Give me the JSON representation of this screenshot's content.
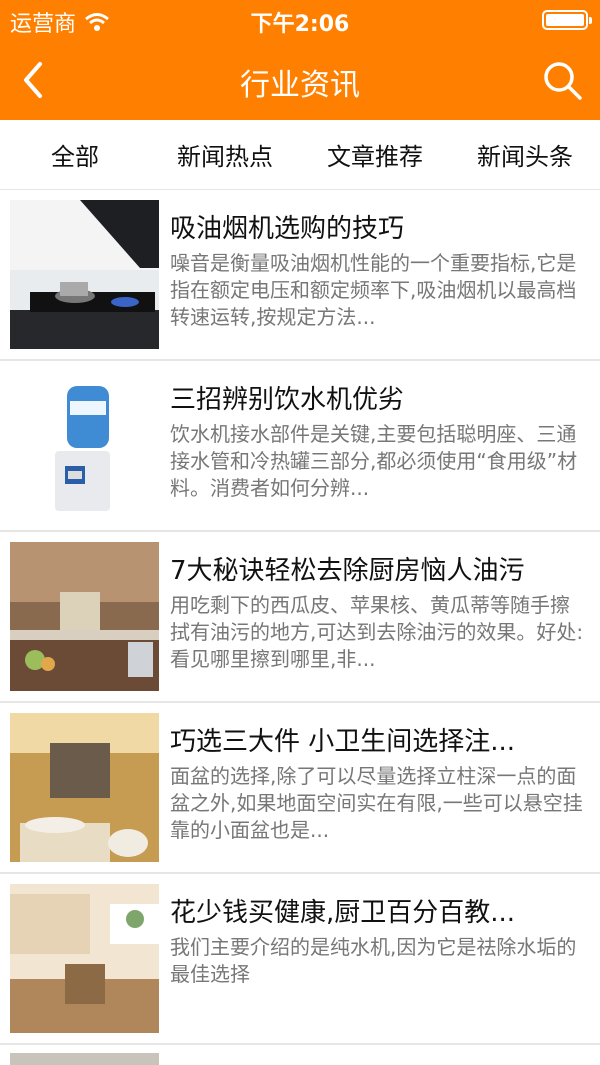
{
  "status": {
    "carrier": "运营商",
    "time": "下午2:06"
  },
  "header": {
    "title": "行业资讯",
    "back_icon": "chevron-left-icon",
    "search_icon": "search-icon",
    "accent_color": "#ff8000"
  },
  "tabs": [
    {
      "label": "全部"
    },
    {
      "label": "新闻热点"
    },
    {
      "label": "文章推荐"
    },
    {
      "label": "新闻头条"
    }
  ],
  "articles": [
    {
      "title": "吸油烟机选购的技巧",
      "summary": "噪音是衡量吸油烟机性能的一个重要指标,它是指在额定电压和额定频率下,吸油烟机以最高档转速运转,按规定方法..."
    },
    {
      "title": "三招辨别饮水机优劣",
      "summary": "饮水机接水部件是关键,主要包括聪明座、三通接水管和冷热罐三部分,都必须使用“食用级”材料。消费者如何分辨..."
    },
    {
      "title": "7大秘诀轻松去除厨房恼人油污",
      "summary": "用吃剩下的西瓜皮、苹果核、黄瓜蒂等随手擦拭有油污的地方,可达到去除油污的效果。好处:看见哪里擦到哪里,非..."
    },
    {
      "title": "巧选三大件 小卫生间选择注...",
      "summary": "面盆的选择,除了可以尽量选择立柱深一点的面盆之外,如果地面空间实在有限,一些可以悬空挂靠的小面盆也是..."
    },
    {
      "title": "花少钱买健康,厨卫百分百教...",
      "summary": "我们主要介绍的是纯水机,因为它是祛除水垢的最佳选择"
    }
  ]
}
